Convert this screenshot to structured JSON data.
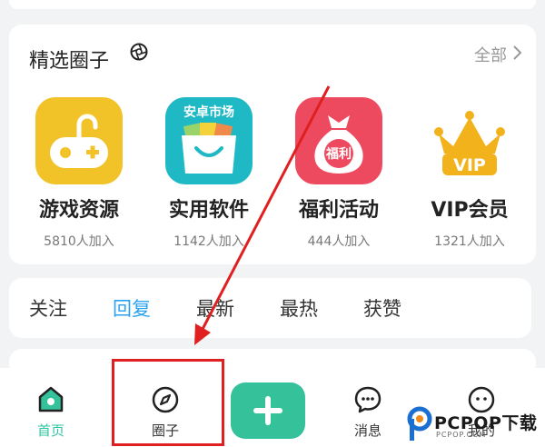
{
  "circles": {
    "title": "精选圈子",
    "see_all": "全部",
    "items": [
      {
        "name": "游戏资源",
        "members": "5810人加入"
      },
      {
        "name": "实用软件",
        "members": "1142人加入",
        "badge": "安卓市场"
      },
      {
        "name": "福利活动",
        "members": "444人加入",
        "badge": "福利"
      },
      {
        "name": "VIP会员",
        "members": "1321人加入",
        "badge": "VIP"
      }
    ]
  },
  "tabs": [
    {
      "label": "关注"
    },
    {
      "label": "回复"
    },
    {
      "label": "最新"
    },
    {
      "label": "最热"
    },
    {
      "label": "获赞"
    }
  ],
  "nav": {
    "home": "首页",
    "circles": "圈子",
    "messages": "消息",
    "mine": "我的"
  },
  "watermark": {
    "brand": "PCPOP下载",
    "url": "PCPOP.COM"
  },
  "colors": {
    "active_tab": "#2aa2f0",
    "accent_green": "#35c29b",
    "annotation_red": "#e02020"
  }
}
